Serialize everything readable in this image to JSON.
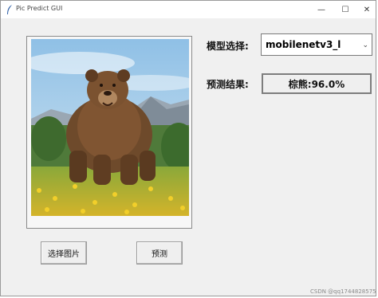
{
  "window": {
    "title": "Pic Predict GUI",
    "controls": {
      "minimize": "—",
      "maximize": "☐",
      "close": "✕"
    }
  },
  "image": {
    "alt": "bear",
    "icon": "bear-photo"
  },
  "model": {
    "label": "模型选择:",
    "selected": "mobilenetv3_l"
  },
  "result": {
    "label": "预测结果:",
    "value": "棕熊:96.0%"
  },
  "buttons": {
    "select_image": "选择图片",
    "predict": "预测"
  },
  "watermark": "CSDN @qq1744828575"
}
